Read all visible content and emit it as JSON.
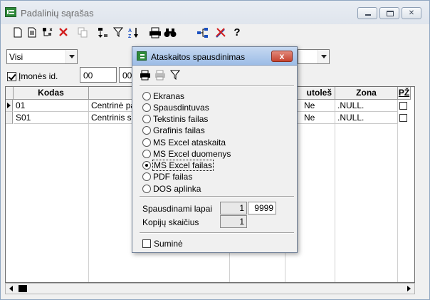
{
  "window": {
    "title": "Padalinių sąrašas"
  },
  "filters": {
    "combo1_value": "Visi",
    "combo2_value": "",
    "company_checkbox_label": "Įmonės id.",
    "company_checkbox_checked": true,
    "company_id_value": "00",
    "second_field_value": "00"
  },
  "grid": {
    "columns": [
      "Kodas",
      "",
      "utoleš",
      "Zona",
      "PŽ"
    ],
    "rows": [
      {
        "kodas": "01",
        "name": "Centrinė pa",
        "flag": "Ne",
        "zona": ".NULL.",
        "pz": false
      },
      {
        "kodas": "S01",
        "name": "Centrinis s",
        "flag": "Ne",
        "zona": ".NULL.",
        "pz": false
      }
    ]
  },
  "dialog": {
    "title": "Ataskaitos spausdinimas",
    "close_glyph": "x",
    "options": [
      {
        "label": "Ekranas",
        "selected": false
      },
      {
        "label": "Spausdintuvas",
        "selected": false
      },
      {
        "label": "Tekstinis failas",
        "selected": false
      },
      {
        "label": "Grafinis failas",
        "selected": false
      },
      {
        "label": "MS Excel ataskaita",
        "selected": false
      },
      {
        "label": "MS Excel duomenys",
        "selected": false
      },
      {
        "label": "MS Excel failas",
        "selected": true
      },
      {
        "label": "PDF failas",
        "selected": false
      },
      {
        "label": "DOS aplinka",
        "selected": false
      }
    ],
    "pages_label": "Spausdinami lapai",
    "pages_from": "1",
    "pages_to": "9999",
    "copies_label": "Kopijų skaičius",
    "copies": "1",
    "sum_label": "Suminė",
    "sum_checked": false
  },
  "icons": {
    "toolbar": [
      "new-icon",
      "edit-icon",
      "tree-icon",
      "delete-icon",
      "copy-icon",
      "sort-icon",
      "filter-icon",
      "sort-az-icon",
      "print-icon",
      "find-icon",
      "hierarchy-icon",
      "tools-icon",
      "help-icon"
    ],
    "dialog_toolbar": [
      "print-icon",
      "printer-setup-icon",
      "filter-icon"
    ]
  },
  "colors": {
    "accent_green": "#2e8a3a",
    "dialog_title_bg": "#9cbce6",
    "close_red": "#c64330"
  }
}
